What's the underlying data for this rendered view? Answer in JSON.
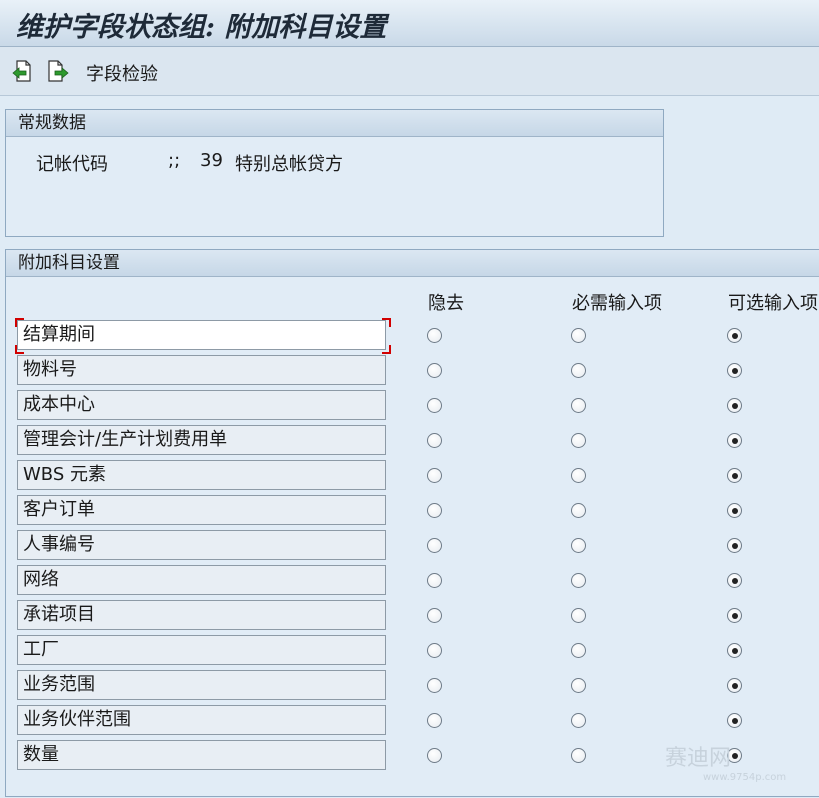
{
  "window": {
    "title": "维护字段状态组: 附加科目设置"
  },
  "toolbar": {
    "field_check_label": "字段检验"
  },
  "general": {
    "header": "常规数据",
    "posting_key_label": "记帐代码",
    "posting_key_sep": ";;",
    "posting_key_value": "39",
    "posting_key_desc": "特别总帐贷方"
  },
  "additional": {
    "header": "附加科目设置",
    "col_suppress": "隐去",
    "col_required": "必需输入项",
    "col_optional": "可选输入项",
    "rows": [
      {
        "label": "结算期间",
        "selected": "optional"
      },
      {
        "label": "物料号",
        "selected": "optional"
      },
      {
        "label": "成本中心",
        "selected": "optional"
      },
      {
        "label": "管理会计/生产计划费用单",
        "selected": "optional"
      },
      {
        "label": "WBS 元素",
        "selected": "optional"
      },
      {
        "label": "客户订单",
        "selected": "optional"
      },
      {
        "label": "人事编号",
        "selected": "optional"
      },
      {
        "label": "网络",
        "selected": "optional"
      },
      {
        "label": "承诺项目",
        "selected": "optional"
      },
      {
        "label": "工厂",
        "selected": "optional"
      },
      {
        "label": "业务范围",
        "selected": "optional"
      },
      {
        "label": "业务伙伴范围",
        "selected": "optional"
      },
      {
        "label": "数量",
        "selected": "optional"
      }
    ]
  },
  "watermark": {
    "text": "赛迪网",
    "url": "www.9754p.com"
  }
}
